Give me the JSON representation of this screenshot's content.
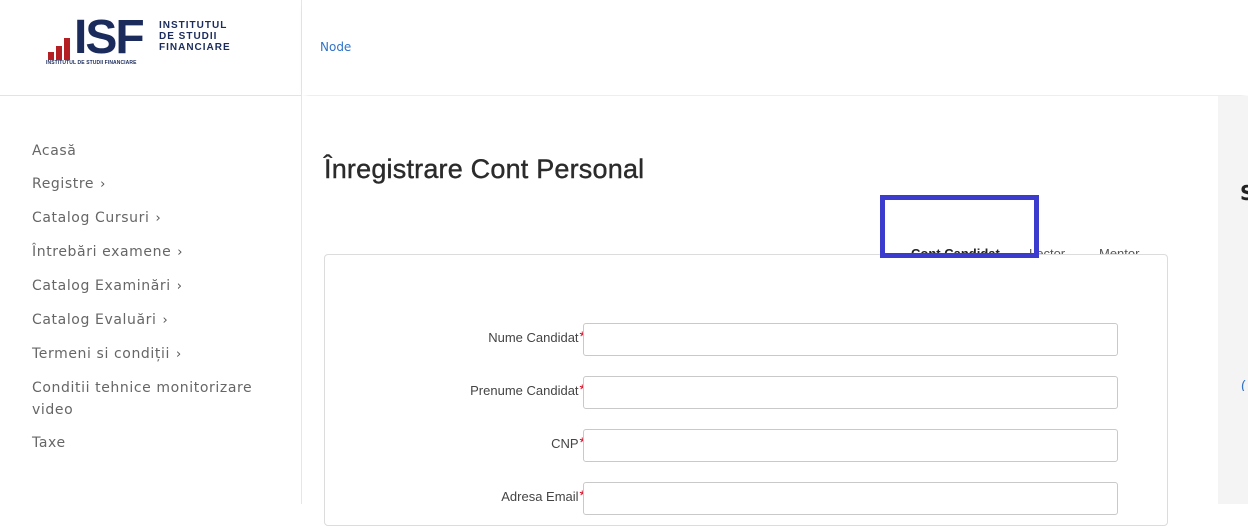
{
  "brand": {
    "logo_letters": "ISF",
    "name_line1": "INSTITUTUL",
    "name_line2": "DE STUDII",
    "name_line3": "FINANCIARE",
    "tagline": "INSTITUTUL DE STUDII FINANCIARE",
    "colors": {
      "navy": "#1b2c5c",
      "red": "#b41f24"
    }
  },
  "breadcrumb": {
    "label": "Node"
  },
  "sidebar": {
    "items": [
      {
        "label": "Acasă",
        "chevron": ""
      },
      {
        "label": "Registre",
        "chevron": "›"
      },
      {
        "label": "Catalog Cursuri",
        "chevron": "›"
      },
      {
        "label": "Întrebări examene",
        "chevron": "›"
      },
      {
        "label": "Catalog Examinări",
        "chevron": "›"
      },
      {
        "label": "Catalog Evaluări",
        "chevron": "›"
      },
      {
        "label": "Termeni si condiții",
        "chevron": "›"
      },
      {
        "label": "Conditii tehnice monitorizare video",
        "chevron": ""
      },
      {
        "label": "Taxe",
        "chevron": ""
      }
    ]
  },
  "page": {
    "title": "Înregistrare Cont Personal"
  },
  "tabs": [
    {
      "label": "Cont Candidat",
      "active": true
    },
    {
      "label": "Lector",
      "active": false
    },
    {
      "label": "Mentor",
      "active": false
    }
  ],
  "form": {
    "required_marker": "*",
    "fields": [
      {
        "label": "Nume Candidat",
        "value": ""
      },
      {
        "label": "Prenume Candidat",
        "value": ""
      },
      {
        "label": "CNP",
        "value": ""
      },
      {
        "label": "Adresa Email",
        "value": ""
      }
    ]
  },
  "colors": {
    "accent": "#3273c7",
    "tab_underline": "#1d5aa8",
    "highlight": "#3b3ccd",
    "required": "#d0021b"
  }
}
